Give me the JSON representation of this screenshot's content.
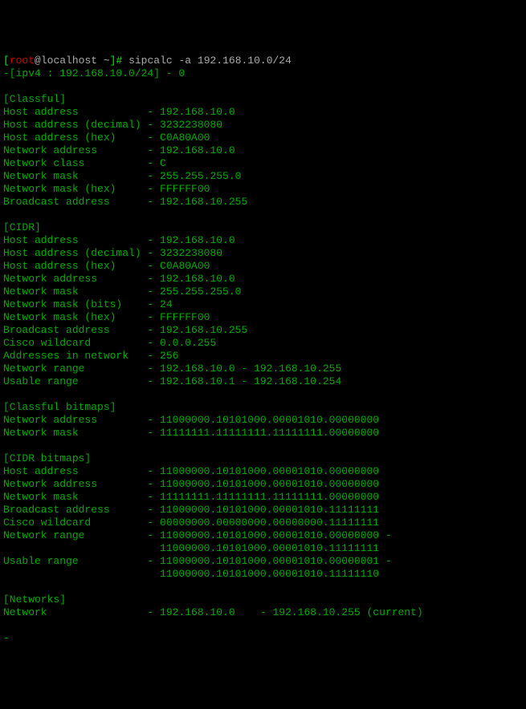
{
  "prompt": {
    "open": "[",
    "user": "root",
    "at": "@",
    "host": "localhost",
    "path": " ~",
    "close": "]# ",
    "command": "sipcalc -a 192.168.10.0/24"
  },
  "header_line": "-[ipv4 : 192.168.10.0/24] - 0",
  "sections": {
    "classful": {
      "title": "[Classful]",
      "items": [
        {
          "label": "Host address",
          "value": "192.168.10.0"
        },
        {
          "label": "Host address (decimal)",
          "value": "3232238080"
        },
        {
          "label": "Host address (hex)",
          "value": "C0A80A00"
        },
        {
          "label": "Network address",
          "value": "192.168.10.0"
        },
        {
          "label": "Network class",
          "value": "C"
        },
        {
          "label": "Network mask",
          "value": "255.255.255.0"
        },
        {
          "label": "Network mask (hex)",
          "value": "FFFFFF00"
        },
        {
          "label": "Broadcast address",
          "value": "192.168.10.255"
        }
      ]
    },
    "cidr": {
      "title": "[CIDR]",
      "items": [
        {
          "label": "Host address",
          "value": "192.168.10.0"
        },
        {
          "label": "Host address (decimal)",
          "value": "3232238080"
        },
        {
          "label": "Host address (hex)",
          "value": "C0A80A00"
        },
        {
          "label": "Network address",
          "value": "192.168.10.0"
        },
        {
          "label": "Network mask",
          "value": "255.255.255.0"
        },
        {
          "label": "Network mask (bits)",
          "value": "24"
        },
        {
          "label": "Network mask (hex)",
          "value": "FFFFFF00"
        },
        {
          "label": "Broadcast address",
          "value": "192.168.10.255"
        },
        {
          "label": "Cisco wildcard",
          "value": "0.0.0.255"
        },
        {
          "label": "Addresses in network",
          "value": "256"
        },
        {
          "label": "Network range",
          "value": "192.168.10.0 - 192.168.10.255"
        },
        {
          "label": "Usable range",
          "value": "192.168.10.1 - 192.168.10.254"
        }
      ]
    },
    "classful_bitmaps": {
      "title": "[Classful bitmaps]",
      "items": [
        {
          "label": "Network address",
          "value": "11000000.10101000.00001010.00000000"
        },
        {
          "label": "Network mask",
          "value": "11111111.11111111.11111111.00000000"
        }
      ]
    },
    "cidr_bitmaps": {
      "title": "[CIDR bitmaps]",
      "items": [
        {
          "label": "Host address",
          "value": "11000000.10101000.00001010.00000000"
        },
        {
          "label": "Network address",
          "value": "11000000.10101000.00001010.00000000"
        },
        {
          "label": "Network mask",
          "value": "11111111.11111111.11111111.00000000"
        },
        {
          "label": "Broadcast address",
          "value": "11000000.10101000.00001010.11111111"
        },
        {
          "label": "Cisco wildcard",
          "value": "00000000.00000000.00000000.11111111"
        },
        {
          "label": "Network range",
          "value": "11000000.10101000.00001010.00000000 -",
          "cont": "11000000.10101000.00001010.11111111"
        },
        {
          "label": "Usable range",
          "value": "11000000.10101000.00001010.00000001 -",
          "cont": "11000000.10101000.00001010.11111110"
        }
      ]
    },
    "networks": {
      "title": "[Networks]",
      "items": [
        {
          "label": "Network",
          "value": "192.168.10.0    - 192.168.10.255 (current)"
        }
      ]
    }
  },
  "trailer": "-"
}
